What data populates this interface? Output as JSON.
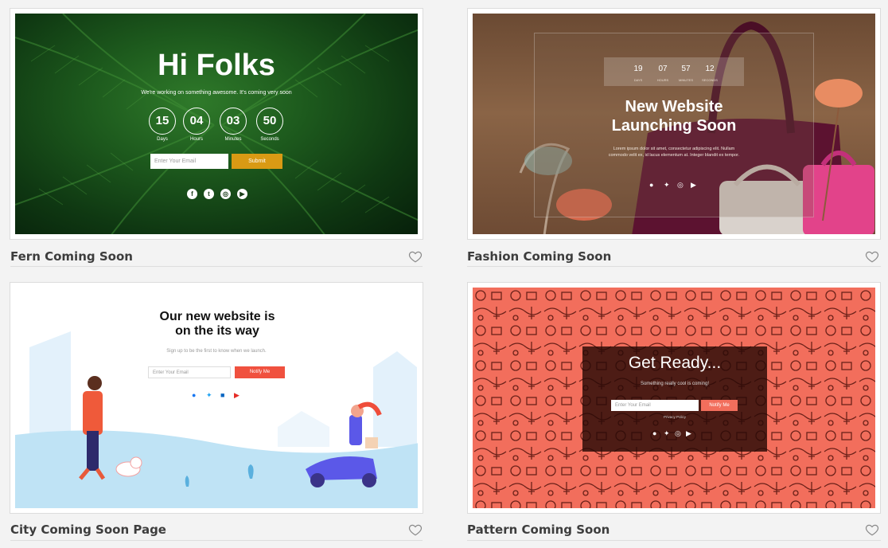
{
  "cards": [
    {
      "title": "Fern Coming Soon"
    },
    {
      "title": "Fashion Coming Soon"
    },
    {
      "title": "City Coming Soon Page"
    },
    {
      "title": "Pattern Coming Soon"
    }
  ],
  "fern": {
    "heading": "Hi Folks",
    "subtitle": "We're working on something awesome. It's coming very soon",
    "countdown": [
      {
        "value": "15",
        "label": "Days"
      },
      {
        "value": "04",
        "label": "Hours"
      },
      {
        "value": "03",
        "label": "Minutes"
      },
      {
        "value": "50",
        "label": "Seconds"
      }
    ],
    "email_placeholder": "Enter Your Email",
    "submit_label": "Submit",
    "social_icons": [
      "facebook-icon",
      "twitter-icon",
      "instagram-icon",
      "youtube-icon"
    ],
    "accent": "#d99a14"
  },
  "fashion": {
    "countdown": [
      {
        "value": "19",
        "label": "DAYS"
      },
      {
        "value": "07",
        "label": "HOURS"
      },
      {
        "value": "57",
        "label": "MINUTES"
      },
      {
        "value": "12",
        "label": "SECONDS"
      }
    ],
    "heading_line1": "New Website",
    "heading_line2": "Launching Soon",
    "body": "Lorem ipsum dolor sit amet, consectetur adipiscing elit. Nullam commodo velit ex, id lacus elementum at. Integer blandit ex tempor.",
    "social_icons": [
      "facebook-icon",
      "twitter-icon",
      "instagram-icon",
      "youtube-icon"
    ]
  },
  "city": {
    "heading_line1": "Our new website is",
    "heading_line2": "on the its way",
    "subtitle": "Sign up to be the first to know when we launch.",
    "email_placeholder": "Enter Your Email",
    "notify_label": "Notify Me",
    "social_icons": [
      "facebook-icon",
      "twitter-icon",
      "linkedin-icon",
      "youtube-icon"
    ],
    "accent": "#f0513f"
  },
  "pattern": {
    "heading": "Get Ready...",
    "subtitle": "Something really cool is coming!",
    "email_placeholder": "Enter Your Email",
    "notify_label": "Notify Me",
    "privacy": "Privacy Policy",
    "social_icons": [
      "facebook-icon",
      "twitter-icon",
      "instagram-icon",
      "youtube-icon"
    ],
    "accent": "#f26e5c"
  }
}
